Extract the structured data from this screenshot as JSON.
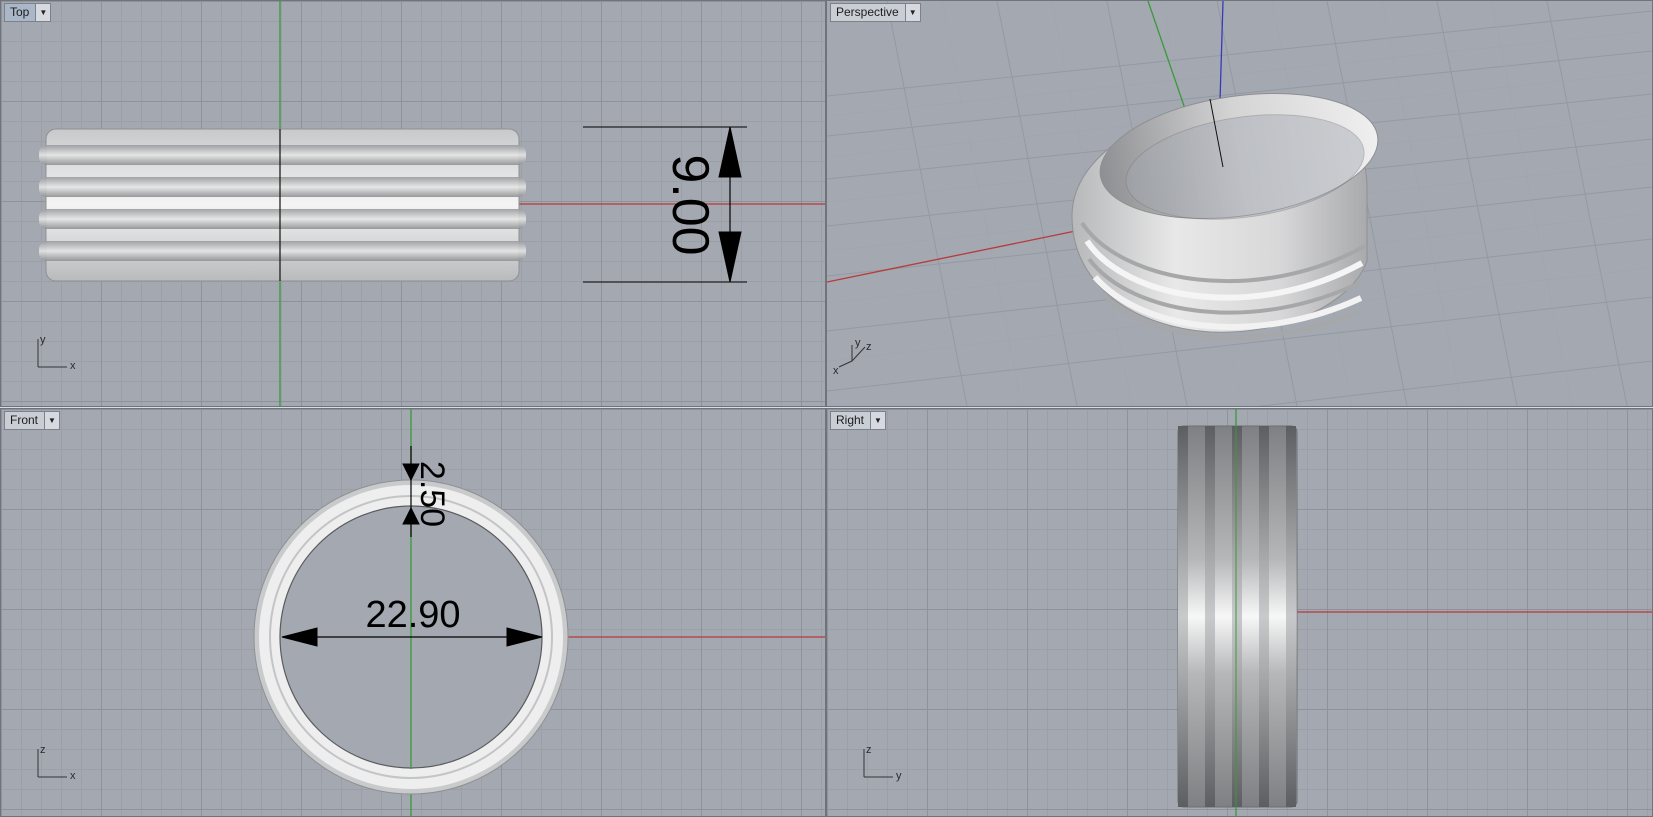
{
  "viewports": {
    "top": {
      "label": "Top",
      "dimension": "9.00",
      "axes": {
        "vertical": "y",
        "horizontal": "x"
      }
    },
    "perspective": {
      "label": "Perspective",
      "axes": {
        "a": "y",
        "b": "z",
        "c": "x"
      }
    },
    "front": {
      "label": "Front",
      "dimension_thickness": "2.50",
      "dimension_diameter": "22.90",
      "axes": {
        "vertical": "z",
        "horizontal": "x"
      }
    },
    "right": {
      "label": "Right",
      "axes": {
        "vertical": "z",
        "horizontal": "y"
      }
    }
  },
  "icons": {
    "viewport_menu": "chevron-down-icon"
  },
  "colors": {
    "viewport_bg": "#a3a8b1",
    "grid_major": "#8d929b",
    "x_axis": "#b83a3a",
    "y_axis": "#3a9a3a",
    "z_axis": "#3a3ab8",
    "ring": "#d9dadb",
    "dimension": "#000000"
  }
}
